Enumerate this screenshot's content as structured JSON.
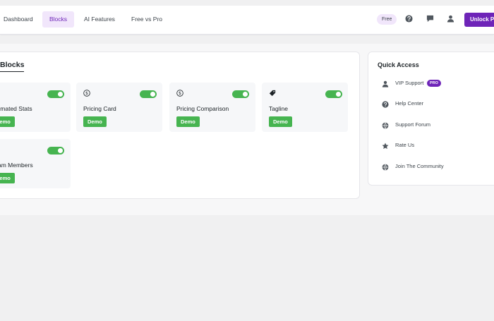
{
  "nav": {
    "items": [
      {
        "label": "Dashboard",
        "active": false
      },
      {
        "label": "Blocks",
        "active": true
      },
      {
        "label": "AI Features",
        "active": false
      },
      {
        "label": "Free vs Pro",
        "active": false
      }
    ],
    "plan_badge": "Free",
    "unlock_label": "Unlock Pro",
    "icons": [
      "help-icon",
      "comment-icon",
      "user-icon"
    ]
  },
  "blocks": {
    "title": "Blocks",
    "cards": [
      {
        "name": "Animated Stats",
        "demo": "Demo",
        "icon": "stats-icon",
        "enabled": true
      },
      {
        "name": "Pricing Card",
        "demo": "Demo",
        "icon": "dollar-icon",
        "enabled": true
      },
      {
        "name": "Pricing Comparison",
        "demo": "Demo",
        "icon": "dollar-icon",
        "enabled": true
      },
      {
        "name": "Tagline",
        "demo": "Demo",
        "icon": "tag-icon",
        "enabled": true
      },
      {
        "name": "Team Members",
        "demo": "Demo",
        "icon": "team-icon",
        "enabled": true
      }
    ]
  },
  "quick_access": {
    "title": "Quick Access",
    "items": [
      {
        "label": "VIP Support",
        "badge": "PRO",
        "icon": "user-icon"
      },
      {
        "label": "Help Center",
        "icon": "help-icon"
      },
      {
        "label": "Support Forum",
        "icon": "forum-icon"
      },
      {
        "label": "Rate Us",
        "icon": "star-icon"
      },
      {
        "label": "Join The Community",
        "icon": "community-icon"
      }
    ]
  },
  "colors": {
    "accent": "#6e24b8",
    "accent_soft": "#f1e6fb",
    "success": "#46b450",
    "icon_gray": "#50575e"
  }
}
